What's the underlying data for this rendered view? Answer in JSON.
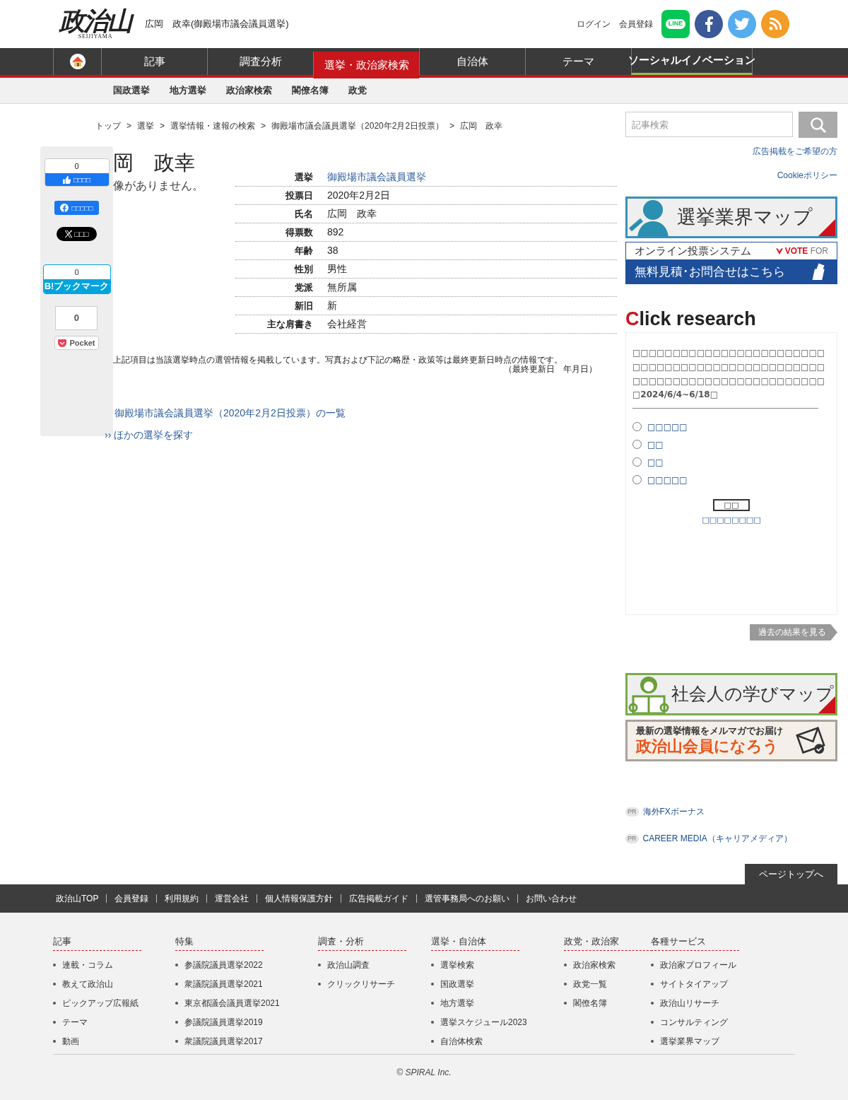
{
  "header": {
    "logo_text": "政治山",
    "logo_sub": "SEIJIYAMA",
    "page_title": "広岡　政幸(御殿場市議会議員選挙)",
    "links": [
      "ログイン",
      "会員登録"
    ],
    "social": [
      {
        "kind": "line",
        "label": "LINE"
      },
      {
        "kind": "facebook"
      },
      {
        "kind": "twitter"
      },
      {
        "kind": "rss"
      }
    ]
  },
  "nav": [
    {
      "kind": "home",
      "selected": false
    },
    {
      "kind": "text",
      "label": "記事",
      "selected": false
    },
    {
      "kind": "text",
      "label": "調査分析",
      "selected": false
    },
    {
      "kind": "text",
      "label": "選挙・政治家検索",
      "selected": true
    },
    {
      "kind": "text",
      "label": "自治体",
      "selected": false
    },
    {
      "kind": "text",
      "label": "テーマ",
      "selected": false
    },
    {
      "kind": "accent",
      "label": "ソーシャルイノベーション",
      "selected": false
    }
  ],
  "subnav": [
    "国政選挙",
    "地方選挙",
    "政治家検索",
    "閣僚名簿",
    "政党"
  ],
  "breadcrumb": {
    "separator": ">",
    "items": [
      "トップ",
      "選挙",
      "選挙情報・速報の検索",
      "御殿場市議会議員選挙（2020年2月2日投票）",
      "広岡　政幸"
    ]
  },
  "share": [
    {
      "kind": "like",
      "count": "0",
      "label": "□□□□"
    },
    {
      "kind": "facebook_share",
      "label": "□□□□□"
    },
    {
      "kind": "x",
      "label": "□□□"
    },
    {
      "kind": "hatena",
      "count": "0",
      "label": "B!ブックマーク"
    },
    {
      "kind": "pocket",
      "count": "0",
      "label": "Pocket"
    }
  ],
  "candidate": {
    "name": "岡　政幸",
    "no_image": "像がありません。",
    "rows": [
      {
        "label": "選挙",
        "value": "御殿場市議会議員選挙",
        "link": true
      },
      {
        "label": "投票日",
        "value": "2020年2月2日",
        "link": false
      },
      {
        "label": "氏名",
        "value": "広岡　政幸",
        "link": false
      },
      {
        "label": "得票数",
        "value": "892",
        "link": false
      },
      {
        "label": "年齢",
        "value": "38",
        "link": false
      },
      {
        "label": "性別",
        "value": "男性",
        "link": false
      },
      {
        "label": "党派",
        "value": "無所属",
        "link": false
      },
      {
        "label": "新旧",
        "value": "新",
        "link": false
      },
      {
        "label": "主な肩書き",
        "value": "会社経営",
        "link": false
      }
    ],
    "note": "上記項目は当該選挙時点の選管情報を掲載しています。写真および下記の略歴・政策等は最終更新日時点の情報です。",
    "updated": "（最終更新日　年月日）",
    "links": [
      {
        "kind": "plain",
        "text": "御殿場市議会議員選挙（2020年2月2日投票）の一覧"
      },
      {
        "kind": "more",
        "marker": "››",
        "text": "ほかの選挙を探す"
      }
    ]
  },
  "sidebar": {
    "search": {
      "placeholder": "記事検索"
    },
    "links": [
      "広告掲載をご希望の方",
      "Cookieポリシー"
    ],
    "banner_map": "選挙業界マップ",
    "banner_vote": {
      "top": "オンライン投票システム",
      "brand_bold": "VOTE",
      "brand_light": "FOR",
      "bottom": "無料見積･お問合せはこちら"
    },
    "click_research": {
      "title_initial": "C",
      "title_rest": "lick research",
      "question": "□□□□□□□□□□□□□□□□□□□□□□□□□□□□□□□□□□□□□□□□□□□□□□□□□□□□□□□□□□□□□□□□□□□□□□□□",
      "period": "□2024/6/4~6/18□",
      "options": [
        {
          "label": "□□□□□",
          "selected": false
        },
        {
          "label": "□□",
          "selected": false
        },
        {
          "label": "□□",
          "selected": false
        },
        {
          "label": "□□□□□",
          "selected": false
        }
      ],
      "vote": "□□",
      "results": "□□□□□□□□",
      "past": "過去の結果を見る"
    },
    "banner_learn": "社会人の学びマップ",
    "banner_member": {
      "top": "最新の選挙情報をメルマガでお届け",
      "main": "政治山会員になろう"
    },
    "pr": [
      {
        "badge": "PR",
        "text": "海外FXボーナス"
      },
      {
        "badge": "PR",
        "text": "CAREER MEDIA（キャリアメディア）"
      }
    ],
    "page_top": "ページトップへ"
  },
  "footer": {
    "links": [
      "政治山TOP",
      "会員登録",
      "利用規約",
      "運営会社",
      "個人情報保護方針",
      "広告掲載ガイド",
      "選管事務局へのお願い",
      "お問い合わせ"
    ],
    "columns": [
      {
        "title": "記事",
        "items": [
          "連載・コラム",
          "教えて政治山",
          "ピックアップ広報紙",
          "テーマ",
          "動画"
        ]
      },
      {
        "title": "特集",
        "items": [
          "参議院議員選挙2022",
          "衆議院議員選挙2021",
          "東京都議会議員選挙2021",
          "参議院議員選挙2019",
          "衆議院議員選挙2017"
        ]
      },
      {
        "title": "調査・分析",
        "items": [
          "政治山調査",
          "クリックリサーチ"
        ]
      },
      {
        "title": "選挙・自治体",
        "items": [
          "選挙検索",
          "国政選挙",
          "地方選挙",
          "選挙スケジュール2023",
          "自治体検索"
        ]
      },
      {
        "title": "政党・政治家",
        "items": [
          "政治家検索",
          "政党一覧",
          "閣僚名簿"
        ]
      },
      {
        "title": "各種サービス",
        "items": [
          "政治家プロフィール",
          "サイトタイアップ",
          "政治山リサーチ",
          "コンサルティング",
          "選挙業界マップ"
        ]
      }
    ],
    "copyright": "© SPIRAL Inc."
  }
}
